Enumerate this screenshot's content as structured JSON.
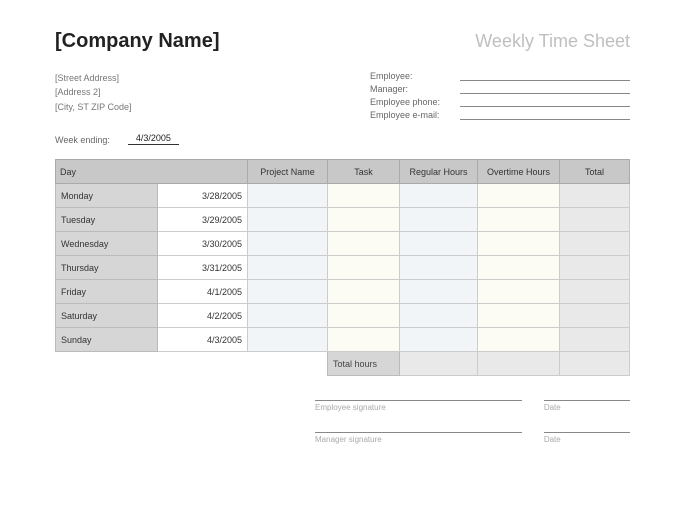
{
  "header": {
    "company": "[Company Name]",
    "title": "Weekly Time Sheet"
  },
  "address": {
    "line1": "[Street Address]",
    "line2": "[Address 2]",
    "line3": "[City, ST  ZIP Code]"
  },
  "employee_fields": {
    "employee": "Employee:",
    "manager": "Manager:",
    "phone": "Employee phone:",
    "email": "Employee e-mail:"
  },
  "week_ending": {
    "label": "Week ending:",
    "value": "4/3/2005"
  },
  "columns": {
    "day": "Day",
    "project": "Project Name",
    "task": "Task",
    "regular": "Regular Hours",
    "overtime": "Overtime Hours",
    "total": "Total"
  },
  "rows": [
    {
      "day": "Monday",
      "date": "3/28/2005"
    },
    {
      "day": "Tuesday",
      "date": "3/29/2005"
    },
    {
      "day": "Wednesday",
      "date": "3/30/2005"
    },
    {
      "day": "Thursday",
      "date": "3/31/2005"
    },
    {
      "day": "Friday",
      "date": "4/1/2005"
    },
    {
      "day": "Saturday",
      "date": "4/2/2005"
    },
    {
      "day": "Sunday",
      "date": "4/3/2005"
    }
  ],
  "totals_label": "Total hours",
  "signatures": {
    "emp": "Employee signature",
    "mgr": "Manager signature",
    "date": "Date"
  }
}
